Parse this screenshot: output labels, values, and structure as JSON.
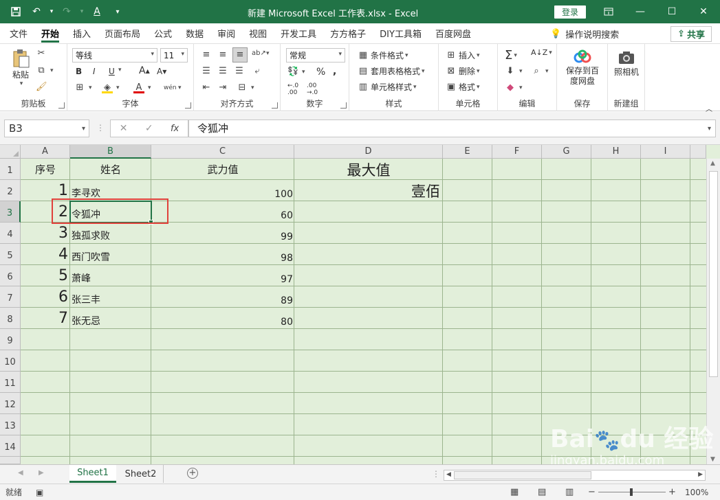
{
  "titlebar": {
    "title": "新建 Microsoft Excel 工作表.xlsx  -  Excel",
    "login": "登录",
    "icons": [
      "save-icon",
      "undo-icon",
      "redo-icon",
      "font-color-icon",
      "customize-icon"
    ]
  },
  "tabs": [
    "文件",
    "开始",
    "插入",
    "页面布局",
    "公式",
    "数据",
    "审阅",
    "视图",
    "开发工具",
    "方方格子",
    "DIY工具箱",
    "百度网盘"
  ],
  "active_tab": "开始",
  "tell_me": "操作说明搜索",
  "share": "共享",
  "ribbon": {
    "clipboard": {
      "label": "剪贴板",
      "paste": "粘贴"
    },
    "font": {
      "label": "字体",
      "name": "等线",
      "size": "11",
      "bold": "B",
      "italic": "I",
      "underline": "U"
    },
    "alignment": {
      "label": "对齐方式"
    },
    "number": {
      "label": "数字",
      "format": "常规",
      "percent": "%"
    },
    "styles": {
      "label": "样式",
      "cond": "条件格式",
      "table": "套用表格格式",
      "cell": "单元格样式"
    },
    "cells": {
      "label": "单元格",
      "insert": "插入",
      "delete": "删除",
      "format": "格式"
    },
    "editing": {
      "label": "编辑"
    },
    "save": {
      "label": "保存",
      "button": "保存到百度网盘"
    },
    "newgroup": {
      "label": "新建组",
      "button": "照相机"
    }
  },
  "formula_bar": {
    "namebox": "B3",
    "fx": "fx",
    "content": "令狐冲"
  },
  "columns": [
    "A",
    "B",
    "C",
    "D",
    "E",
    "F",
    "G",
    "H",
    "I"
  ],
  "rows": [
    "1",
    "2",
    "3",
    "4",
    "5",
    "6",
    "7",
    "8",
    "9",
    "10",
    "11",
    "12",
    "13",
    "14"
  ],
  "cells": {
    "header_a": "序号",
    "header_b": "姓名",
    "header_c": "武力值",
    "header_d": "最大值",
    "d2": "壹佰",
    "data": [
      {
        "no": "1",
        "name": "李寻欢",
        "value": "100"
      },
      {
        "no": "2",
        "name": "令狐冲",
        "value": "60"
      },
      {
        "no": "3",
        "name": "独孤求败",
        "value": "99"
      },
      {
        "no": "4",
        "name": "西门吹雪",
        "value": "98"
      },
      {
        "no": "5",
        "name": "萧峰",
        "value": "97"
      },
      {
        "no": "6",
        "name": "张三丰",
        "value": "89"
      },
      {
        "no": "7",
        "name": "张无忌",
        "value": "80"
      }
    ]
  },
  "sheets": [
    "Sheet1",
    "Sheet2"
  ],
  "active_sheet": "Sheet1",
  "status": {
    "ready": "就绪",
    "zoom": "100%"
  },
  "watermark": {
    "main": "Bai du 经验",
    "sub": "jingyan.baidu.com"
  },
  "colors": {
    "accent": "#217346",
    "grid_bg": "#e2efda",
    "highlight": "#e0403a"
  }
}
